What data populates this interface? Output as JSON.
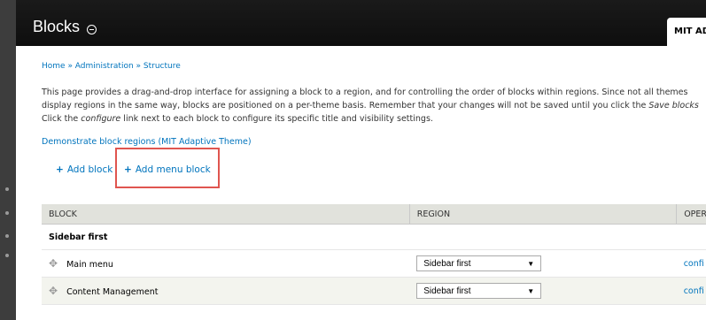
{
  "header": {
    "title": "Blocks",
    "theme_tab": "MIT AD"
  },
  "breadcrumb": {
    "text": "Home » Administration » Structure"
  },
  "description": {
    "line1": "This page provides a drag-and-drop interface for assigning a block to a region, and for controlling the order of blocks within regions. Since not all themes",
    "line2_start": "display regions in the same way, blocks are positioned on a per-theme basis. Remember that your changes will not be saved until you click the ",
    "line2_em": "Save blocks",
    "line3_start": "Click the ",
    "line3_em": "configure",
    "line3_end": " link next to each block to configure its specific title and visibility settings."
  },
  "demo_link": "Demonstrate block regions (MIT Adaptive Theme)",
  "actions": {
    "add_block": "Add block",
    "add_menu_block": "Add menu block",
    "plus": "+"
  },
  "table": {
    "headers": {
      "block": "BLOCK",
      "region": "REGION",
      "operations": "OPER"
    },
    "region_label": "Sidebar first",
    "rows": [
      {
        "block": "Main menu",
        "region": "Sidebar first",
        "op": "confi"
      },
      {
        "block": "Content Management",
        "region": "Sidebar first",
        "op": "confi"
      }
    ]
  }
}
